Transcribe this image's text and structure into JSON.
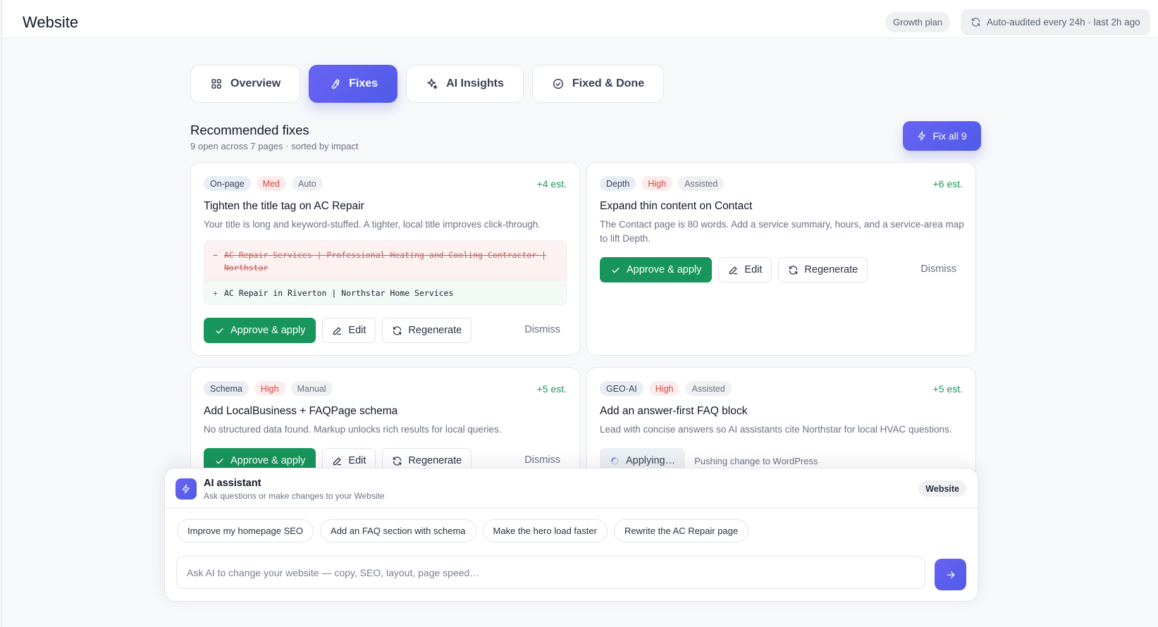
{
  "topbar": {
    "title": "Website",
    "plan": "Growth plan",
    "audit": "Auto-audited every 24h · last 2h ago"
  },
  "tabs": [
    {
      "label": "Overview",
      "icon": "grid-icon"
    },
    {
      "label": "Fixes",
      "icon": "wrench-icon",
      "active": true
    },
    {
      "label": "AI Insights",
      "icon": "sparkle-icon"
    },
    {
      "label": "Fixed & Done",
      "icon": "check-circle-icon"
    }
  ],
  "section": {
    "title": "Recommended fixes",
    "subtitle": "9 open across 7 pages · sorted by impact",
    "fix_all": "Fix all 9"
  },
  "cards": [
    {
      "tags": [
        "On-page",
        "Med",
        "Auto"
      ],
      "est": "+4 est.",
      "title": "Tighten the title tag on AC Repair",
      "desc": "Your title is long and keyword-stuffed. A tighter, local title improves click-through.",
      "diff_del": "AC Repair Services | Professional Heating and Cooling Contractor | Northstar",
      "diff_add": "AC Repair in Riverton | Northstar Home Services",
      "approve": "Approve & apply",
      "edit": "Edit",
      "regenerate": "Regenerate",
      "dismiss": "Dismiss"
    },
    {
      "tags": [
        "Depth",
        "High",
        "Assisted"
      ],
      "est": "+6 est.",
      "title": "Expand thin content on Contact",
      "desc": "The Contact page is 80 words. Add a service summary, hours, and a service-area map to lift Depth.",
      "approve": "Approve & apply",
      "edit": "Edit",
      "regenerate": "Regenerate",
      "dismiss": "Dismiss"
    },
    {
      "tags": [
        "Schema",
        "High",
        "Manual"
      ],
      "est": "+5 est.",
      "title": "Add LocalBusiness + FAQPage schema",
      "desc": "No structured data found. Markup unlocks rich results for local queries.",
      "approve": "Approve & apply",
      "edit": "Edit",
      "regenerate": "Regenerate",
      "dismiss": "Dismiss"
    },
    {
      "tags": [
        "GEO·AI",
        "High",
        "Assisted"
      ],
      "est": "+5 est.",
      "title": "Add an answer-first FAQ block",
      "desc": "Lead with concise answers so AI assistants cite Northstar for local HVAC questions.",
      "applying": "Applying…",
      "pushing": "Pushing change to WordPress"
    }
  ],
  "assistant": {
    "title": "AI assistant",
    "subtitle": "Ask questions or make changes to your Website",
    "badge": "Website",
    "chips": [
      "Improve my homepage SEO",
      "Add an FAQ section with schema",
      "Make the hero load faster",
      "Rewrite the AC Repair page"
    ],
    "placeholder": "Ask AI to change your website — copy, SEO, layout, page speed…"
  },
  "colors": {
    "accent": "#5b5ff0",
    "success": "#17955a",
    "priority": "#d2453f"
  }
}
